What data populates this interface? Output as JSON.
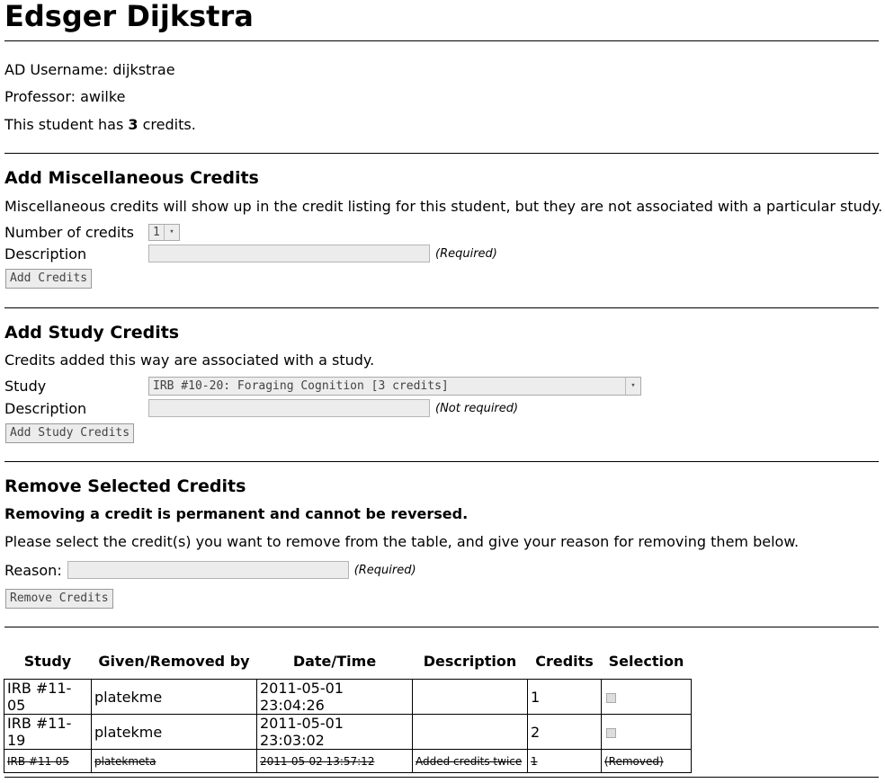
{
  "header": {
    "title": "Edsger Dijkstra"
  },
  "student": {
    "ad_username_label": "AD Username: ",
    "ad_username": "dijkstrae",
    "professor_label": "Professor: ",
    "professor": "awilke",
    "credits_prefix": "This student has ",
    "credits_count": "3",
    "credits_suffix": " credits."
  },
  "misc": {
    "heading": "Add Miscellaneous Credits",
    "intro": "Miscellaneous credits will show up in the credit listing for this student, but they are not associated with a particular study.",
    "num_label": "Number of credits",
    "num_value": "1",
    "desc_label": "Description",
    "desc_hint": "(Required)",
    "button": "Add Credits"
  },
  "study": {
    "heading": "Add Study Credits",
    "intro": "Credits added this way are associated with a study.",
    "study_label": "Study",
    "study_value": "IRB #10-20: Foraging Cognition [3 credits]",
    "desc_label": "Description",
    "desc_hint": "(Not required)",
    "button": "Add Study Credits"
  },
  "remove": {
    "heading": "Remove Selected Credits",
    "warning": "Removing a credit is permanent and cannot be reversed.",
    "intro": "Please select the credit(s) you want to remove from the table, and give your reason for removing them below.",
    "reason_label": "Reason:",
    "reason_hint": "(Required)",
    "button": "Remove Credits"
  },
  "table": {
    "headers": [
      "Study",
      "Given/Removed by",
      "Date/Time",
      "Description",
      "Credits",
      "Selection"
    ],
    "rows": [
      {
        "study": "IRB #11-05",
        "by": "platekme",
        "datetime": "2011-05-01 23:04:26",
        "description": "",
        "credits": "1",
        "selection": ""
      },
      {
        "study": "IRB #11-19",
        "by": "platekme",
        "datetime": "2011-05-01 23:03:02",
        "description": "",
        "credits": "2",
        "selection": ""
      },
      {
        "study": "IRB #11-05",
        "by": "platekmeta",
        "datetime": "2011-05-02 13:57:12",
        "description": "Added credits twice",
        "credits": "1",
        "selection": "(Removed)"
      }
    ]
  }
}
